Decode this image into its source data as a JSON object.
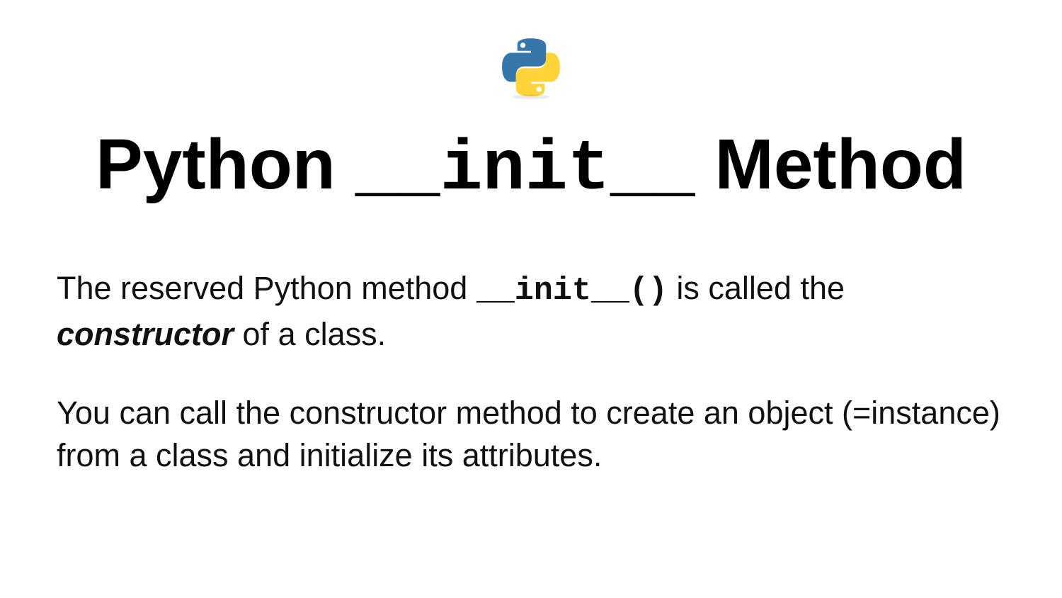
{
  "logo": {
    "name": "python-logo",
    "blue": "#3776ab",
    "yellow": "#ffd43b"
  },
  "title": {
    "part1": "Python ",
    "mono": "__init__",
    "part3": " Method"
  },
  "paragraph1": {
    "pre": "The reserved Python method ",
    "mono": "__init__()",
    "mid": " is called the ",
    "emph": "constructor",
    "suffix": " of a class."
  },
  "paragraph2": {
    "text": "You can call the constructor method to create an object (=instance) from a class and initialize its attributes."
  }
}
